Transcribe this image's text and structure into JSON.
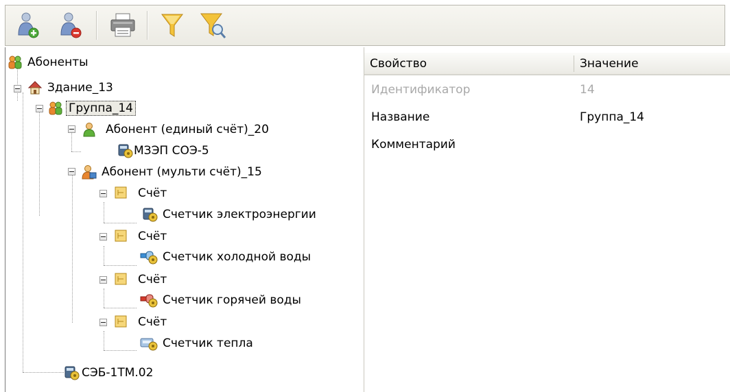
{
  "toolbar": {
    "buttons": [
      {
        "name": "add-subscriber-button",
        "icon": "user-add-icon"
      },
      {
        "name": "remove-subscriber-button",
        "icon": "user-remove-icon"
      },
      {
        "name": "print-button",
        "icon": "printer-icon"
      },
      {
        "name": "filter-button",
        "icon": "filter-icon"
      },
      {
        "name": "filter-search-button",
        "icon": "filter-search-icon"
      }
    ]
  },
  "tree": {
    "root": "Абоненты",
    "building": "Здание_13",
    "group": "Группа_14",
    "single_account": "Абонент (единый счёт)_20",
    "single_meter": "МЗЭП СОЭ-5",
    "multi_account": "Абонент (мульти счёт)_15",
    "accounts": [
      {
        "label": "Счёт",
        "meter": "Счетчик электроэнергии",
        "meter_icon": "electricity-meter-icon"
      },
      {
        "label": "Счёт",
        "meter": "Счетчик холодной воды",
        "meter_icon": "cold-water-meter-icon"
      },
      {
        "label": "Счёт",
        "meter": "Счетчик горячей воды",
        "meter_icon": "hot-water-meter-icon"
      },
      {
        "label": "Счёт",
        "meter": "Счетчик тепла",
        "meter_icon": "heat-meter-icon"
      }
    ],
    "building_meter": "СЭБ-1ТМ.02"
  },
  "properties": {
    "col_property": "Свойство",
    "col_value": "Значение",
    "rows": [
      {
        "name": "Идентификатор",
        "value": "14",
        "readonly": true
      },
      {
        "name": "Название",
        "value": "Группа_14",
        "readonly": false
      },
      {
        "name": "Комментарий",
        "value": "",
        "readonly": false
      }
    ]
  },
  "colors": {
    "toolbar_bg": "#ecebe4",
    "folder_yellow": "#f4c542",
    "user_green": "#5fb13a",
    "user_orange": "#e8862f",
    "readonly_text": "#a9a9a9"
  }
}
